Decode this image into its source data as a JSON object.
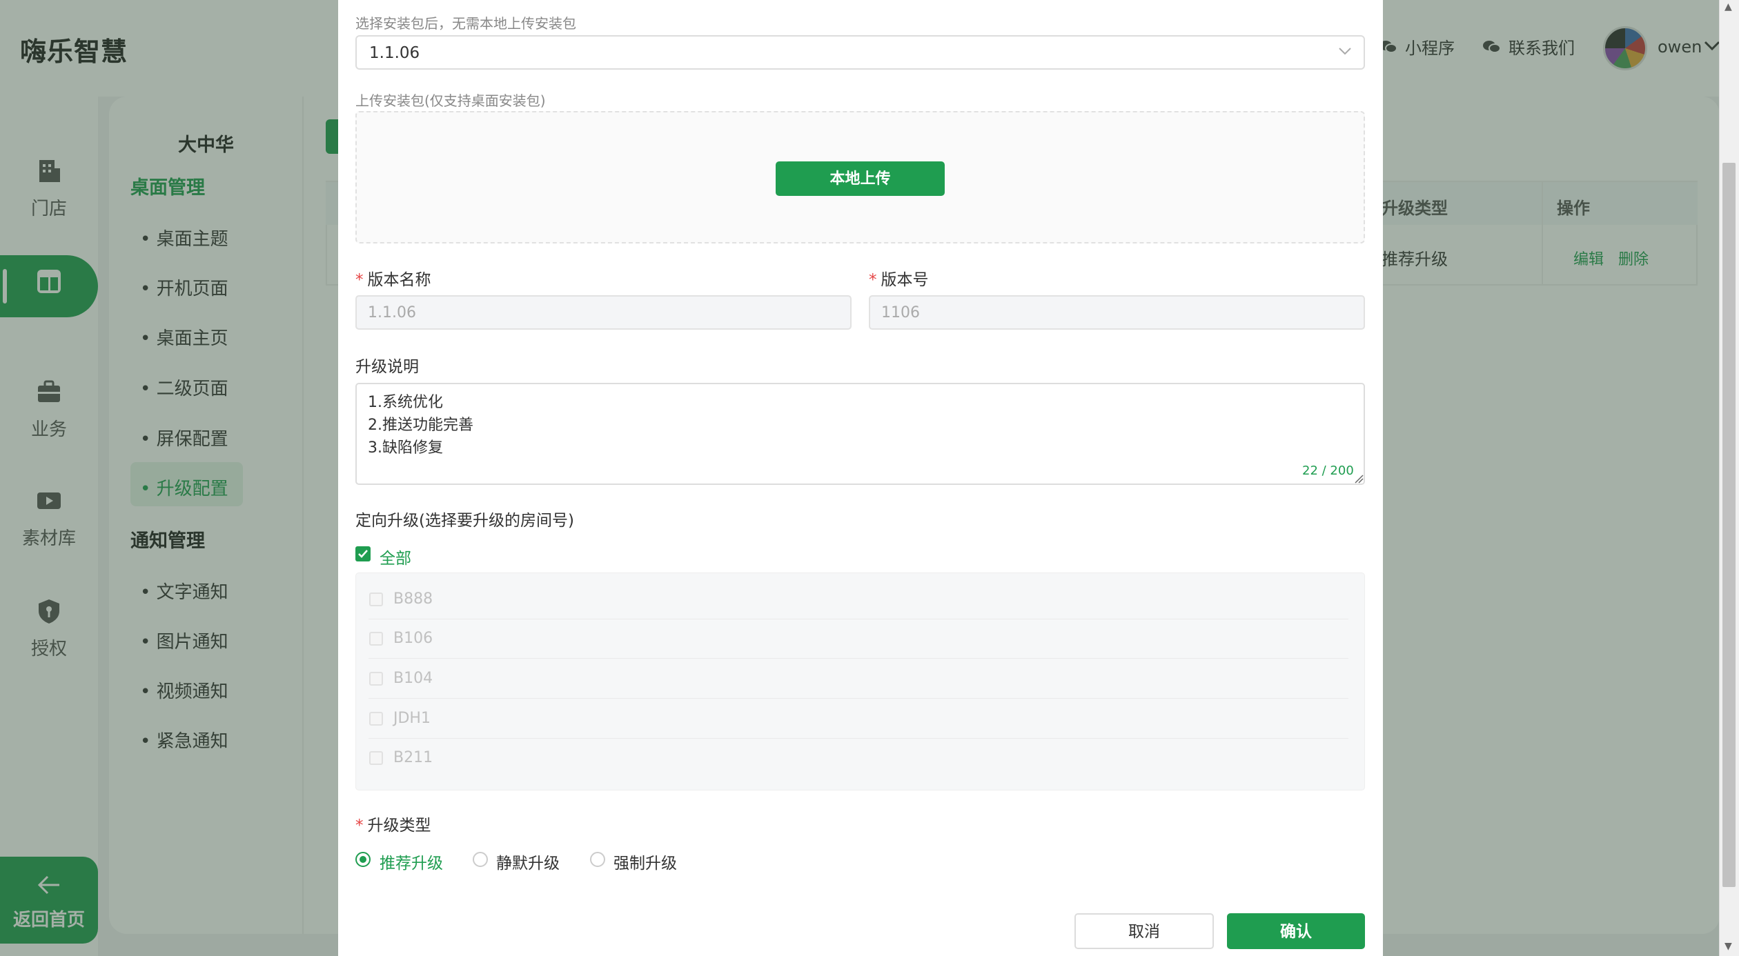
{
  "app": {
    "brand": "嗨乐智慧"
  },
  "header": {
    "mini_program": "小程序",
    "contact_us": "联系我们",
    "username": "owen"
  },
  "leftnav": {
    "items": [
      {
        "label": "门店",
        "icon": "building-icon"
      },
      {
        "label": "桌面",
        "icon": "desktop-layout-icon",
        "active": true
      },
      {
        "label": "业务",
        "icon": "briefcase-icon"
      },
      {
        "label": "素材库",
        "icon": "video-icon"
      },
      {
        "label": "授权",
        "icon": "shield-key-icon"
      }
    ],
    "back_home": "返回首页"
  },
  "sub_sidebar": {
    "group": "大中华",
    "sections": [
      {
        "title": "桌面管理",
        "items": [
          "• 桌面主题",
          "• 开机页面",
          "• 桌面主页",
          "• 二级页面",
          "• 屏保配置",
          "• 升级配置"
        ],
        "active_index": 5
      },
      {
        "title": "通知管理",
        "items": [
          "• 文字通知",
          "• 图片通知",
          "• 视频通知",
          "• 紧急通知"
        ]
      }
    ]
  },
  "table": {
    "headers": {
      "upgrade_type": "升级类型",
      "actions": "操作"
    },
    "row": {
      "upgrade_type": "推荐升级",
      "edit": "编辑",
      "delete": "删除"
    }
  },
  "modal": {
    "package_hint": "选择安装包后，无需本地上传安装包",
    "package_selected": "1.1.06",
    "upload_label": "上传安装包(仅支持桌面安装包)",
    "upload_button": "本地上传",
    "version_name_label": "版本名称",
    "version_name_value": "1.1.06",
    "version_code_label": "版本号",
    "version_code_value": "1106",
    "description_label": "升级说明",
    "description_lines": [
      "1.系统优化",
      "2.推送功能完善",
      "3.缺陷修复"
    ],
    "description_counter": "22 / 200",
    "targeted_label": "定向升级(选择要升级的房间号)",
    "select_all_label": "全部",
    "select_all_checked": true,
    "rooms": [
      "B888",
      "B106",
      "B104",
      "JDH1",
      "B211"
    ],
    "upgrade_type_label": "升级类型",
    "upgrade_types": [
      {
        "label": "推荐升级",
        "checked": true
      },
      {
        "label": "静默升级",
        "checked": false
      },
      {
        "label": "强制升级",
        "checked": false
      }
    ],
    "cancel_button": "取消",
    "confirm_button": "确认"
  },
  "colors": {
    "primary": "#1f9d50",
    "required": "#e54545",
    "overlay": "rgba(55,80,60,0.45)"
  }
}
